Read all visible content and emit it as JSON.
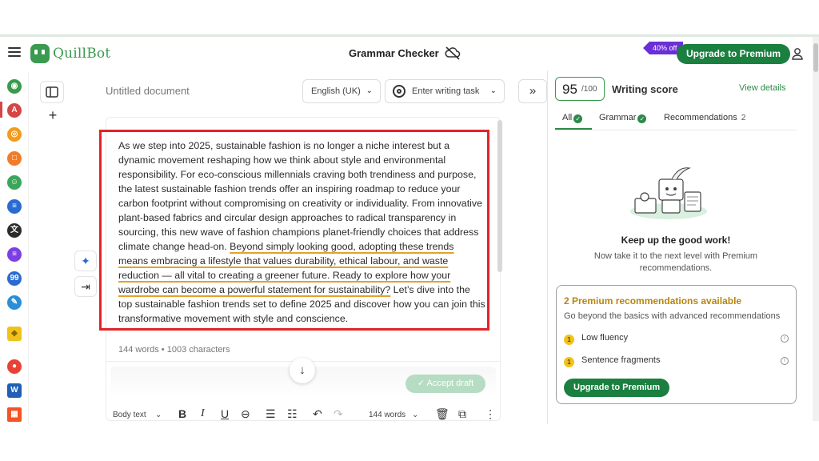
{
  "header": {
    "brand": "QuillBot",
    "title": "Grammar Checker",
    "promo_badge": "40% off",
    "upgrade_label": "Upgrade to Premium"
  },
  "rail": {
    "items": [
      {
        "name": "paraphraser",
        "color": "#3a9a4f"
      },
      {
        "name": "grammar-checker",
        "color": "#d64545"
      },
      {
        "name": "ai-detector",
        "color": "#f29b1d"
      },
      {
        "name": "plagiarism-checker",
        "color": "#f07c2a"
      },
      {
        "name": "ai-humanizer",
        "color": "#3aa65a"
      },
      {
        "name": "summarizer",
        "color": "#2a6bd1"
      },
      {
        "name": "translator",
        "color": "#2b2b2b"
      },
      {
        "name": "citation-generator",
        "color": "#7b3fe4"
      },
      {
        "name": "quote-finder",
        "color": "#2a6bd1"
      },
      {
        "name": "essay-writer",
        "color": "#2a8fd8"
      },
      {
        "name": "premium",
        "color": "#f1c21b"
      },
      {
        "name": "chrome-extension",
        "color": "#e94235"
      },
      {
        "name": "word-addin",
        "color": "#1f5fb5"
      },
      {
        "name": "windows-app",
        "color": "#f35325"
      }
    ]
  },
  "editor": {
    "doc_title": "Untitled document",
    "language": "English (UK)",
    "task_placeholder": "Enter writing task",
    "text_plain": "As we step into 2025, sustainable fashion is no longer a niche interest but a dynamic movement reshaping how we think about style and environmental responsibility. For eco-conscious millennials craving both trendiness and purpose, the latest sustainable fashion trends offer an inspiring roadmap to reduce your carbon footprint without compromising on creativity or individuality. From innovative plant-based fabrics and circular design approaches to radical transparency in sourcing, this new wave of fashion champions planet-friendly choices that address climate change head-on. ",
    "text_highlight": "Beyond simply looking good, adopting these trends means embracing a lifestyle that values durability, ethical labour, and waste reduction — all vital to creating a greener future. Ready to explore how your wardrobe can become a powerful statement for sustainability?",
    "text_tail": " Let’s dive into the top sustainable fashion trends set to define 2025 and discover how you can join this transformative movement with style and conscience.",
    "word_count": "144 words • 1003 characters",
    "accept_label": "Accept draft",
    "toolbar": {
      "style": "Body text",
      "words": "144 words"
    }
  },
  "panel": {
    "score": "95",
    "score_total": "/100",
    "score_label": "Writing score",
    "view_details": "View details",
    "tabs": {
      "all": "All",
      "grammar": "Grammar",
      "recommendations": "Recommendations",
      "recommendations_count": "2"
    },
    "keep_title": "Keep up the good work!",
    "keep_sub": "Now take it to the next level with Premium recommendations.",
    "premium": {
      "title": "2 Premium recommendations available",
      "subtitle": "Go beyond the basics with advanced recommendations",
      "items": [
        {
          "count": "1",
          "label": "Low fluency"
        },
        {
          "count": "1",
          "label": "Sentence fragments"
        }
      ],
      "button": "Upgrade to Premium"
    }
  },
  "colors": {
    "brand_green": "#3a9a4f",
    "button_green": "#1a7f3f",
    "highlight_box": "#e1242a",
    "underline": "#e0a32a",
    "promo": "#6b2fd6"
  }
}
